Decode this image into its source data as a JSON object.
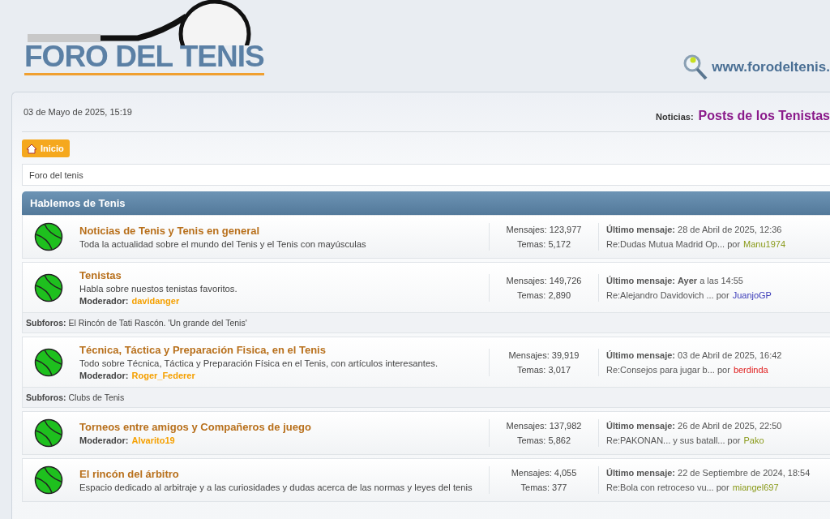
{
  "header": {
    "logo_text": "FORO DEL TENIS",
    "site_url": "www.forodeltenis."
  },
  "topbar": {
    "date": "03 de Mayo de 2025, 15:19",
    "news_label": "Noticias:",
    "news_text": "Posts de los Tenistas"
  },
  "menu": [
    {
      "label": "Inicio",
      "selected": true
    }
  ],
  "breadcrumb": "Foro del tenis",
  "category": {
    "title": "Hablemos de Tenis",
    "boards": [
      {
        "title": "Noticias de Tenis y Tenis en general",
        "description": "Toda la actualidad sobre el mundo del Tenis y el Tenis con mayúsculas",
        "posts": "Mensajes: 123,977",
        "topics": "Temas: 5,172",
        "last_post": "**Último mensaje:** 28 de Abril de 2025, 12:36",
        "last_topic": "Re:Dudas Mutua Madrid Op... por",
        "last_user": "Manu1974",
        "color": "#8a9a1a"
      },
      {
        "title": "Tenistas",
        "description": "Habla sobre nuestos tenistas favoritos.",
        "moderator_label": "Moderador:",
        "moderator": "davidanger",
        "posts": "Mensajes: 149,726",
        "topics": "Temas: 2,890",
        "last_post": "**Último mensaje:** **Ayer** a las 14:55",
        "last_topic": "Re:Alejandro Davidovich ... por",
        "last_user": "JuanjoGP",
        "color": "#3a3ab8",
        "subforums": "**Subforos:** El Rincón de Tati Rascón. 'Un grande del Tenis'"
      },
      {
        "title": "Técnica, Táctica y Preparación Fisica, en el Tenis",
        "description": "Todo sobre Técnica, Táctica y Preparación  Física en el Tenis, con artículos interesantes.",
        "moderator_label": "Moderador:",
        "moderator": "Roger_Federer",
        "posts": "Mensajes: 39,919",
        "topics": "Temas: 3,017",
        "last_post": "**Último mensaje:** 03 de Abril de 2025, 16:42",
        "last_topic": "Re:Consejos para jugar b... por",
        "last_user": "berdinda",
        "color": "#e02020",
        "subforums": "**Subforos:** Clubs de Tenis"
      },
      {
        "title": "Torneos entre amigos y Compañeros de juego",
        "moderator_label": "Moderador:",
        "moderator": "Alvarito19",
        "posts": "Mensajes: 137,982",
        "topics": "Temas: 5,862",
        "last_post": "**Último mensaje:** 26 de Abril de 2025, 22:50",
        "last_topic": "Re:PAKONAN... y sus batall... por",
        "last_user": "Pako",
        "color": "#8a9a1a"
      },
      {
        "title": "El rincón del árbitro",
        "description": "Espacio dedicado al arbitraje y a las curiosidades y dudas acerca de las normas y leyes del tenis",
        "posts": "Mensajes: 4,055",
        "topics": "Temas: 377",
        "last_post": "**Último mensaje:** 22 de Septiembre de 2024, 18:54",
        "last_topic": "Re:Bola con retroceso vu... por",
        "last_user": "miangel697",
        "color": "#8a9a1a"
      }
    ]
  }
}
